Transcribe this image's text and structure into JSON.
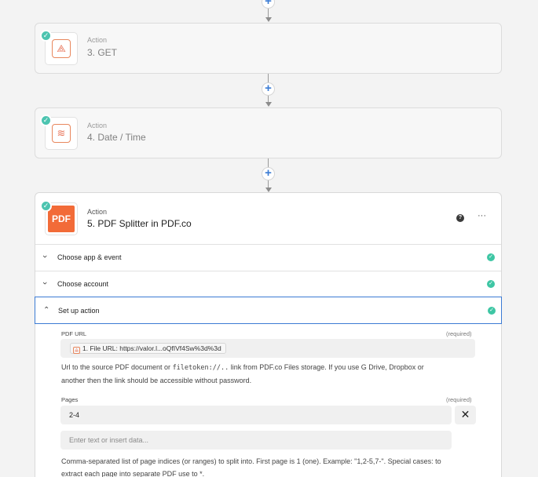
{
  "steps": [
    {
      "eyebrow": "Action",
      "title": "3. GET",
      "icon": "webhook-icon"
    },
    {
      "eyebrow": "Action",
      "title": "4. Date / Time",
      "icon": "formatter-icon"
    }
  ],
  "active_step": {
    "eyebrow": "Action",
    "title": "5. PDF Splitter in PDF.co",
    "icon_text": "PDF",
    "help_icon": "?",
    "more_icon": "···"
  },
  "sections": [
    {
      "label": "Choose app & event",
      "chevron": "›",
      "done": "✓"
    },
    {
      "label": "Choose account",
      "chevron": "›",
      "done": "✓"
    },
    {
      "label": "Set up action",
      "chevron": "⌃",
      "done": "✓"
    }
  ],
  "pdf_url_field": {
    "label": "PDF URL",
    "required": "(required)",
    "pill_icon": "webhook-icon",
    "pill_text": "1. File URL: https://valor.l...oQfIVf4Sw%3d%3d",
    "help_part1": "Url to the source PDF document or ",
    "help_code": "filetoken://..",
    "help_part2": " link from PDF.co Files storage. If you use G Drive, Dropbox or",
    "help_line2": "another then the link should be accessible without password."
  },
  "pages_field": {
    "label": "Pages",
    "required": "(required)",
    "value": "2-4",
    "clear_label": "✕",
    "placeholder": "Enter text or insert data...",
    "help_line1": "Comma-separated list of page indices (or ranges) to split into. First page is 1 (one). Example: \"1,2-5,7-\". Special cases: to",
    "help_line2": "extract each page into separate PDF use to *."
  },
  "colors": {
    "accent": "#3b7bd4",
    "success": "#3ec6a4",
    "pdf_brand": "#f26b38",
    "app_icon": "#e8765b"
  }
}
